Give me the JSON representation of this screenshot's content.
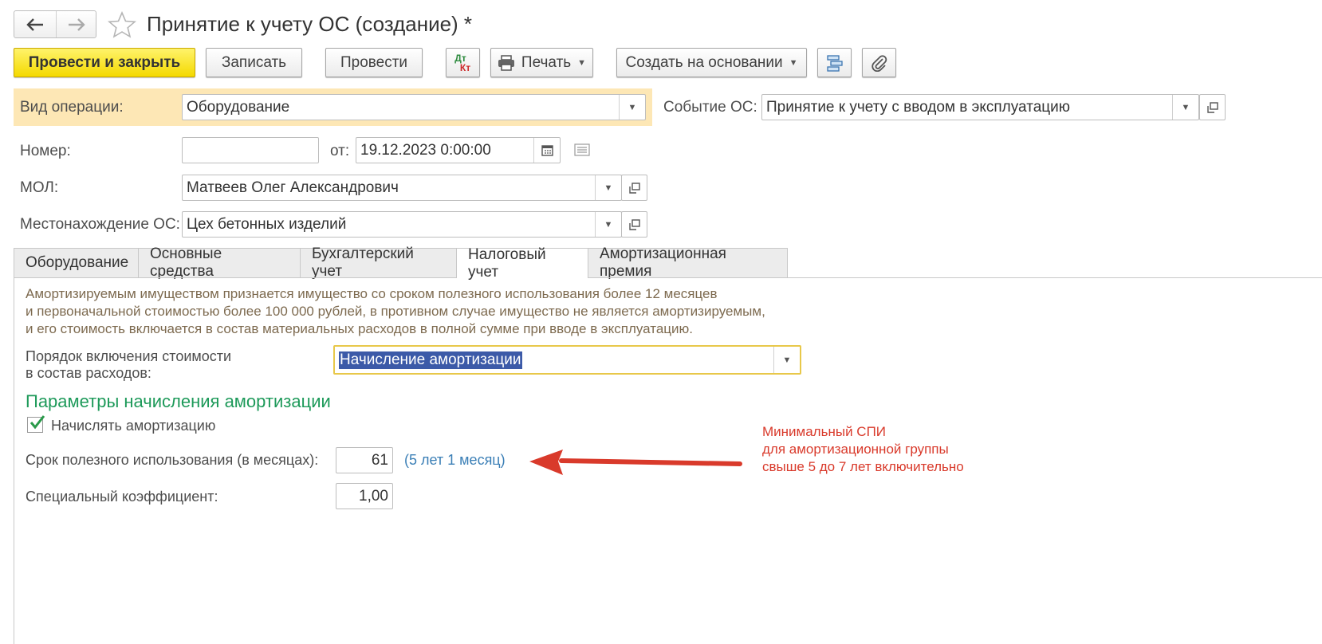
{
  "header": {
    "title": "Принятие к учету ОС (создание) *",
    "back_icon": "arrow-left-icon",
    "forward_icon": "arrow-right-icon",
    "favorite_icon": "star-icon"
  },
  "toolbar": {
    "post_close_label": "Провести и закрыть",
    "save_label": "Записать",
    "post_label": "Провести",
    "dtkt_dt": "Дт",
    "dtkt_kt": "Кт",
    "print_label": "Печать",
    "create_based_label": "Создать на основании"
  },
  "form": {
    "operation_label": "Вид операции:",
    "operation_value": "Оборудование",
    "event_label": "Событие ОС:",
    "event_value": "Принятие к учету с вводом в эксплуатацию",
    "number_label": "Номер:",
    "number_value": "",
    "date_from_label": "от:",
    "date_value": "19.12.2023  0:00:00",
    "mol_label": "МОЛ:",
    "mol_value": "Матвеев Олег Александрович",
    "location_label": "Местонахождение ОС:",
    "location_value": "Цех бетонных изделий"
  },
  "tabs": [
    {
      "label": "Оборудование"
    },
    {
      "label": "Основные средства"
    },
    {
      "label": "Бухгалтерский учет"
    },
    {
      "label": "Налоговый учет"
    },
    {
      "label": "Амортизационная премия"
    }
  ],
  "tax": {
    "info_line1": "Амортизируемым имуществом признается имущество со сроком полезного использования более 12 месяцев",
    "info_line2": "и первоначальной стоимостью более 100 000 рублей, в противном случае имущество не является амортизируемым,",
    "info_line3": "и его стоимость включается в состав материальных расходов в полной сумме при вводе в эксплуатацию.",
    "order_label_line1": "Порядок включения стоимости",
    "order_label_line2": "в состав расходов:",
    "order_value": "Начисление амортизации",
    "params_heading": "Параметры начисления амортизации",
    "accrue_label": "Начислять амортизацию",
    "accrue_checked": true,
    "useful_life_label": "Срок полезного использования (в месяцах):",
    "useful_life_value": "61",
    "useful_life_hint": "(5 лет 1 месяц)",
    "coef_label": "Специальный коэффициент:",
    "coef_value": "1,00"
  },
  "annotation": {
    "line1": "Минимальный СПИ",
    "line2": "для амортизационной группы",
    "line3": "свыше 5 до 7 лет включительно",
    "color": "#d93a2b"
  },
  "colors": {
    "primary_button": "#f4d900",
    "highlight_row": "#fde7b5",
    "heading_green": "#1e9a5a",
    "info_text": "#7d6a4f",
    "hint_blue": "#3b7fb6",
    "selection": "#3c5aa8"
  }
}
